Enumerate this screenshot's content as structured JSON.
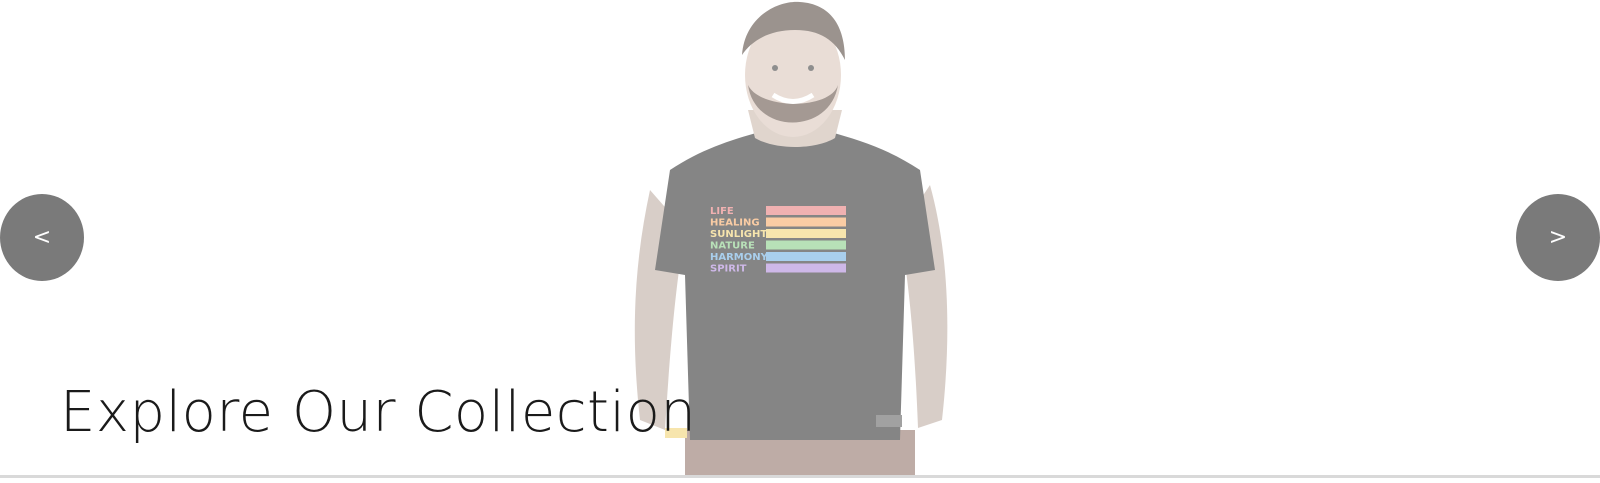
{
  "slider": {
    "prev_label": "<",
    "next_label": ">",
    "headline": "Explore Our Collection"
  },
  "shirt_print": {
    "lines": [
      "LIFE",
      "HEALING",
      "SUNLIGHT",
      "NATURE",
      "HARMONY",
      "SPIRIT"
    ],
    "stripe_colors": [
      "#e57373",
      "#f6a35b",
      "#f2d16b",
      "#7fc97f",
      "#64a8e0",
      "#a77fd6"
    ]
  },
  "colors": {
    "arrow_bg": "#7a7a7a",
    "headline": "#1a1a1a",
    "shirt": "#222222"
  },
  "icons": {
    "model": "person-in-rainbow-tshirt-image"
  }
}
